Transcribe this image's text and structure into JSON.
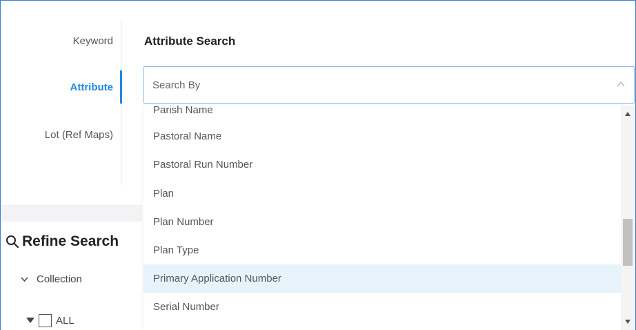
{
  "tabs": [
    {
      "label": "Keyword",
      "active": false
    },
    {
      "label": "Attribute",
      "active": true
    },
    {
      "label": "Lot (Ref Maps)",
      "active": false
    }
  ],
  "section": {
    "title": "Attribute Search"
  },
  "select": {
    "placeholder": "Search By",
    "expanded": true
  },
  "dropdown": {
    "options": [
      "Parish Name",
      "Pastoral Name",
      "Pastoral Run Number",
      "Plan",
      "Plan Number",
      "Plan Type",
      "Primary Application Number",
      "Serial Number"
    ],
    "highlighted": "Primary Application Number"
  },
  "refine": {
    "title": "Refine Search"
  },
  "filters": {
    "collection_label": "Collection",
    "all_label": "ALL"
  },
  "colors": {
    "accent": "#1e88e5",
    "highlight": "#e6f3fb",
    "border": "#8cb8e8"
  }
}
